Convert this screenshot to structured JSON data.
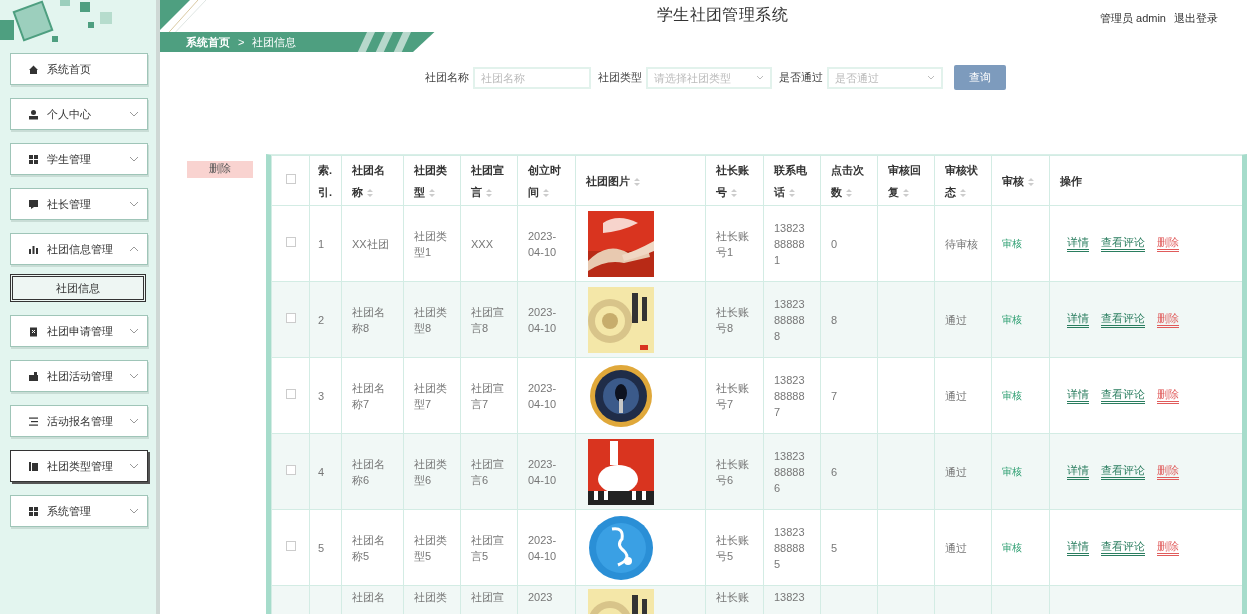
{
  "app_title": "学生社团管理系统",
  "user": {
    "label": "管理员 admin",
    "logout": "退出登录"
  },
  "sidebar": {
    "items": [
      {
        "label": "系统首页",
        "kind": "link",
        "hovered": false
      },
      {
        "label": "个人中心",
        "kind": "group",
        "expanded": false,
        "hovered": false
      },
      {
        "label": "学生管理",
        "kind": "group",
        "expanded": false,
        "hovered": false
      },
      {
        "label": "社长管理",
        "kind": "group",
        "expanded": false,
        "hovered": false
      },
      {
        "label": "社团信息管理",
        "kind": "group",
        "expanded": true,
        "hovered": false,
        "children": [
          {
            "label": "社团信息",
            "selected": true
          }
        ]
      },
      {
        "label": "社团申请管理",
        "kind": "group",
        "expanded": false,
        "hovered": false
      },
      {
        "label": "社团活动管理",
        "kind": "group",
        "expanded": false,
        "hovered": false
      },
      {
        "label": "活动报名管理",
        "kind": "group",
        "expanded": false,
        "hovered": false
      },
      {
        "label": "社团类型管理",
        "kind": "group",
        "expanded": false,
        "hovered": true
      },
      {
        "label": "系统管理",
        "kind": "group",
        "expanded": false,
        "hovered": false
      }
    ]
  },
  "breadcrumb": {
    "items": [
      "系统首页",
      "社团信息"
    ],
    "separator": ">"
  },
  "search": {
    "fields": [
      {
        "label": "社团名称",
        "placeholder": "社团名称",
        "kind": "text"
      },
      {
        "label": "社团类型",
        "placeholder": "请选择社团类型",
        "kind": "select"
      },
      {
        "label": "是否通过",
        "placeholder": "是否通过",
        "kind": "select"
      }
    ],
    "button": "查询"
  },
  "delete_button": "删除",
  "table": {
    "select_all_checked": false,
    "columns": [
      {
        "label": "索.引.",
        "sortable": false
      },
      {
        "label": "社团名称",
        "sortable": true
      },
      {
        "label": "社团类型",
        "sortable": true
      },
      {
        "label": "社团宣言",
        "sortable": true
      },
      {
        "label": "创立时间",
        "sortable": true
      },
      {
        "label": "社团图片",
        "sortable": true
      },
      {
        "label": "社长账号",
        "sortable": true
      },
      {
        "label": "联系电话",
        "sortable": true
      },
      {
        "label": "点击次数",
        "sortable": true
      },
      {
        "label": "审核回复",
        "sortable": true
      },
      {
        "label": "审核状态",
        "sortable": true
      },
      {
        "label": "审核",
        "sortable": true
      },
      {
        "label": "操作",
        "sortable": false
      }
    ],
    "rows": [
      {
        "checked": false,
        "index": "1",
        "name": "XX社团",
        "type": "社团类型1",
        "slogan": "XXX",
        "created": "2023-04-10",
        "account": "社长账号1",
        "phone": "13823888881",
        "clicks": "0",
        "status": "待审核",
        "review": "审核",
        "actions": [
          {
            "label": "详情",
            "kind": "link"
          },
          {
            "label": "查看评论",
            "kind": "link"
          },
          {
            "label": "删除",
            "kind": "danger"
          }
        ]
      },
      {
        "checked": false,
        "index": "2",
        "name": "社团名称8",
        "type": "社团类型8",
        "slogan": "社团宣言8",
        "created": "2023-04-10",
        "account": "社长账号8",
        "phone": "13823888888",
        "clicks": "8",
        "status": "通过",
        "review": "审核",
        "actions": [
          {
            "label": "详情",
            "kind": "link"
          },
          {
            "label": "查看评论",
            "kind": "link"
          },
          {
            "label": "删除",
            "kind": "danger"
          }
        ]
      },
      {
        "checked": false,
        "index": "3",
        "name": "社团名称7",
        "type": "社团类型7",
        "slogan": "社团宣言7",
        "created": "2023-04-10",
        "account": "社长账号7",
        "phone": "13823888887",
        "clicks": "7",
        "status": "通过",
        "review": "审核",
        "actions": [
          {
            "label": "详情",
            "kind": "link"
          },
          {
            "label": "查看评论",
            "kind": "link"
          },
          {
            "label": "删除",
            "kind": "danger"
          }
        ]
      },
      {
        "checked": false,
        "index": "4",
        "name": "社团名称6",
        "type": "社团类型6",
        "slogan": "社团宣言6",
        "created": "2023-04-10",
        "account": "社长账号6",
        "phone": "13823888886",
        "clicks": "6",
        "status": "通过",
        "review": "审核",
        "actions": [
          {
            "label": "详情",
            "kind": "link"
          },
          {
            "label": "查看评论",
            "kind": "link"
          },
          {
            "label": "删除",
            "kind": "danger"
          }
        ]
      },
      {
        "checked": false,
        "index": "5",
        "name": "社团名称5",
        "type": "社团类型5",
        "slogan": "社团宣言5",
        "created": "2023-04-10",
        "account": "社长账号5",
        "phone": "13823888885",
        "clicks": "5",
        "status": "通过",
        "review": "审核",
        "actions": [
          {
            "label": "详情",
            "kind": "link"
          },
          {
            "label": "查看评论",
            "kind": "link"
          },
          {
            "label": "删除",
            "kind": "danger"
          }
        ]
      },
      {
        "partial": true,
        "name": "社团名",
        "type": "社团类",
        "slogan": "社团宣",
        "created": "2023",
        "account": "社长账",
        "phone": "13823"
      }
    ]
  }
}
